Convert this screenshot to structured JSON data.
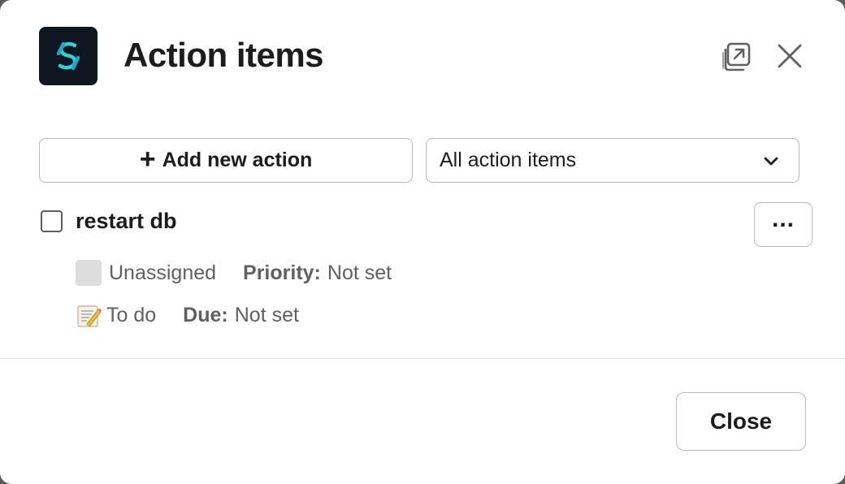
{
  "header": {
    "title": "Action items",
    "logo_icon": "app-logo-icon",
    "popout_icon": "open-in-new-window-icon",
    "close_icon": "close-icon"
  },
  "controls": {
    "add_label": "Add new action",
    "filter_selected": "All action items"
  },
  "item": {
    "title": "restart db",
    "checked": false,
    "assignee": "Unassigned",
    "priority_label": "Priority:",
    "priority_value": "Not set",
    "status": "To do",
    "due_label": "Due:",
    "due_value": "Not set"
  },
  "footer": {
    "close_label": "Close"
  },
  "colors": {
    "logo_bg": "#0f1620",
    "logo_accent": "#2fd3d6",
    "text": "#1d1c1d",
    "muted": "#616061",
    "border": "#b9b9b9"
  }
}
